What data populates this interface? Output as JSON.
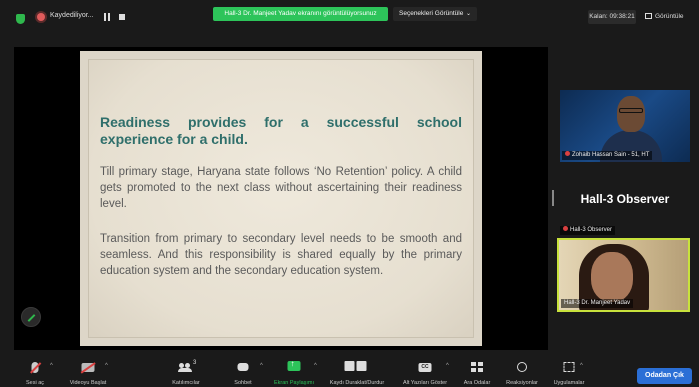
{
  "topbar": {
    "recording_label": "Kaydediliyor...",
    "share_banner": "Hall-3 Dr. Manjeet Yadav ekranını görüntülüyorsunuz",
    "view_options": "Seçenekleri Görüntüle",
    "timer": "Kalan: 09:38:21",
    "view_button": "Görüntüle"
  },
  "slide": {
    "heading": "Readiness provides for a successful school experience for a child.",
    "para1": "Till primary stage, Haryana state follows ‘No Retention’ policy. A child gets promoted to the next class without ascertaining their readiness level.",
    "para2": "Transition from primary to secondary level needs to be smooth and seamless. And this responsibility is shared equally by the primary education system and the secondary education system."
  },
  "participants": {
    "p1_name": "Zohaib Hassan Sain - 51, HT",
    "observer_title": "Hall-3 Observer",
    "observer_tag": "Hall-3 Observer",
    "p2_name": "Hall-3 Dr. Manjeet Yadav"
  },
  "toolbar": {
    "mute": "Sesi aç",
    "video": "Videoyu Başlat",
    "participants": "Katılımcılar",
    "participants_count": "3",
    "chat": "Sohbet",
    "share": "Ekran Paylaşımı",
    "pause_share": "Kaydı Duraklat/Durdur",
    "captions": "Alt Yazıları Göster",
    "breakout": "Ara Odalar",
    "reactions": "Reaksiyonlar",
    "apps": "Uygulamalar",
    "end": "Odadan Çık"
  },
  "colors": {
    "accent_green": "#2dc45a",
    "end_blue": "#2b6fd6",
    "heading_teal": "#2f6f6b",
    "active_speaker": "#c8e23c"
  }
}
